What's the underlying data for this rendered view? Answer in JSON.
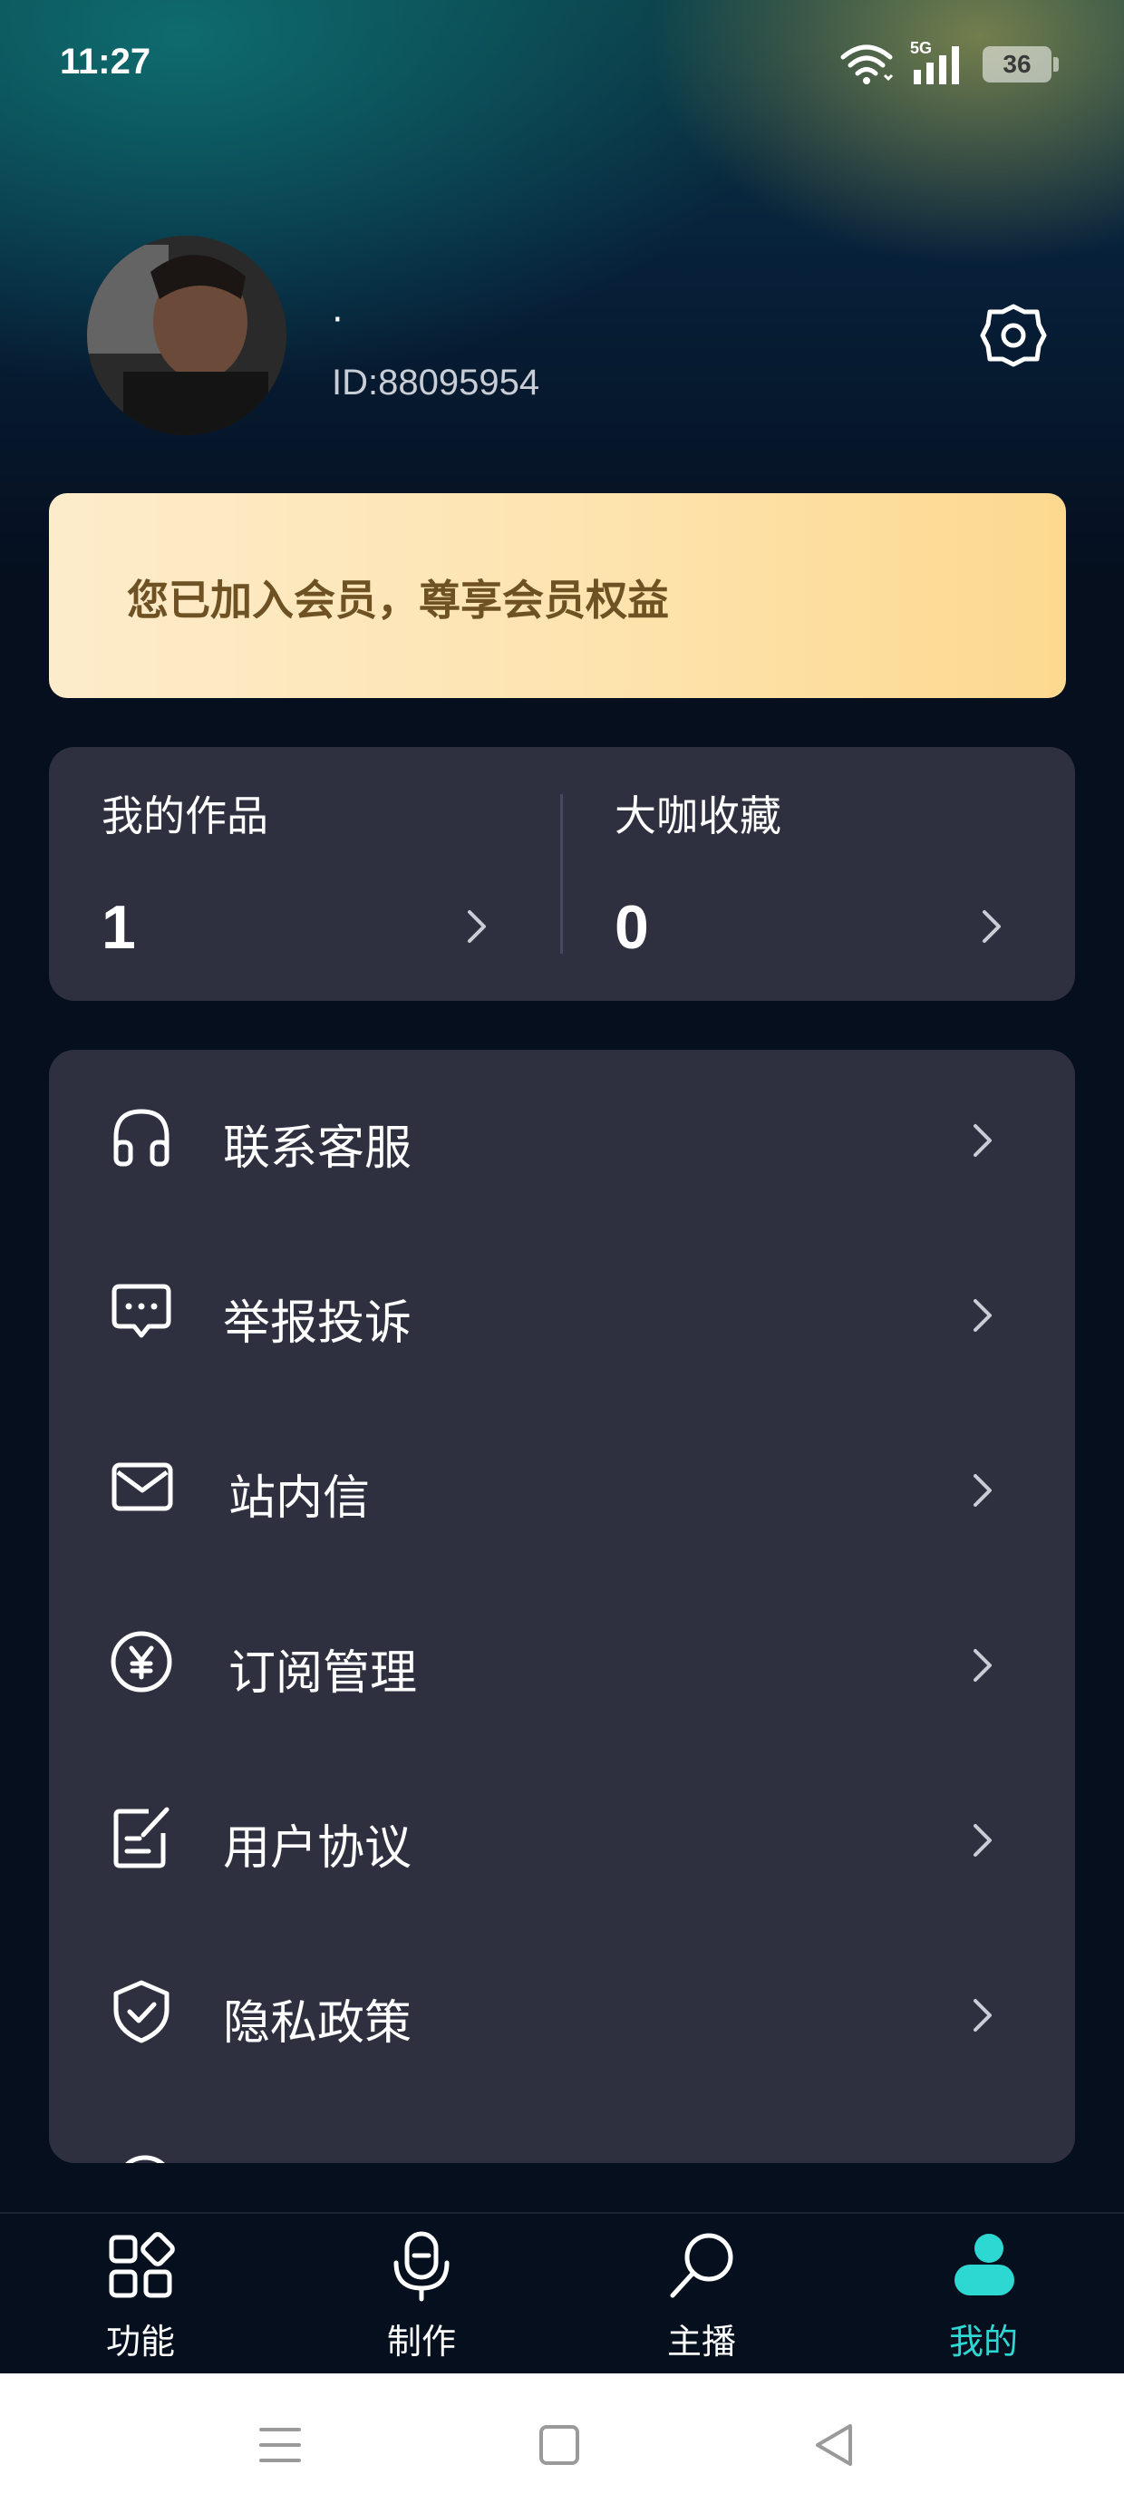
{
  "status_bar": {
    "time": "11:27",
    "network": "5G",
    "battery": "36",
    "icons": [
      "wifi-icon",
      "signal-icon",
      "battery-icon"
    ]
  },
  "profile": {
    "nickname": "·",
    "user_id": "ID:88095954",
    "icons": [
      "avatar",
      "settings-icon"
    ]
  },
  "vip_banner": {
    "text": "您已加入会员，尊享会员权益"
  },
  "stats": [
    {
      "label": "我的作品",
      "count": "1"
    },
    {
      "label": "大咖收藏",
      "count": "0"
    }
  ],
  "menu": [
    {
      "label": "联系客服",
      "icon": "headset-icon"
    },
    {
      "label": "举报投诉",
      "icon": "chat-bubble-icon"
    },
    {
      "label": "站内信",
      "icon": "mail-icon"
    },
    {
      "label": "订阅管理",
      "icon": "yen-circle-icon"
    },
    {
      "label": "用户协议",
      "icon": "document-edit-icon"
    },
    {
      "label": "隐私政策",
      "icon": "shield-check-icon"
    }
  ],
  "tabs": [
    {
      "label": "功能",
      "icon": "grid-apps-icon",
      "active": false
    },
    {
      "label": "制作",
      "icon": "microphone-icon",
      "active": false
    },
    {
      "label": "主播",
      "icon": "search-person-icon",
      "active": false
    },
    {
      "label": "我的",
      "icon": "user-icon",
      "active": true
    }
  ],
  "colors": {
    "accent": "#2ed8d2",
    "card_bg": "#2e3040",
    "page_bg": "#050f1e",
    "vip_text": "#6e5224",
    "vip_bg": "#fde3ae"
  }
}
